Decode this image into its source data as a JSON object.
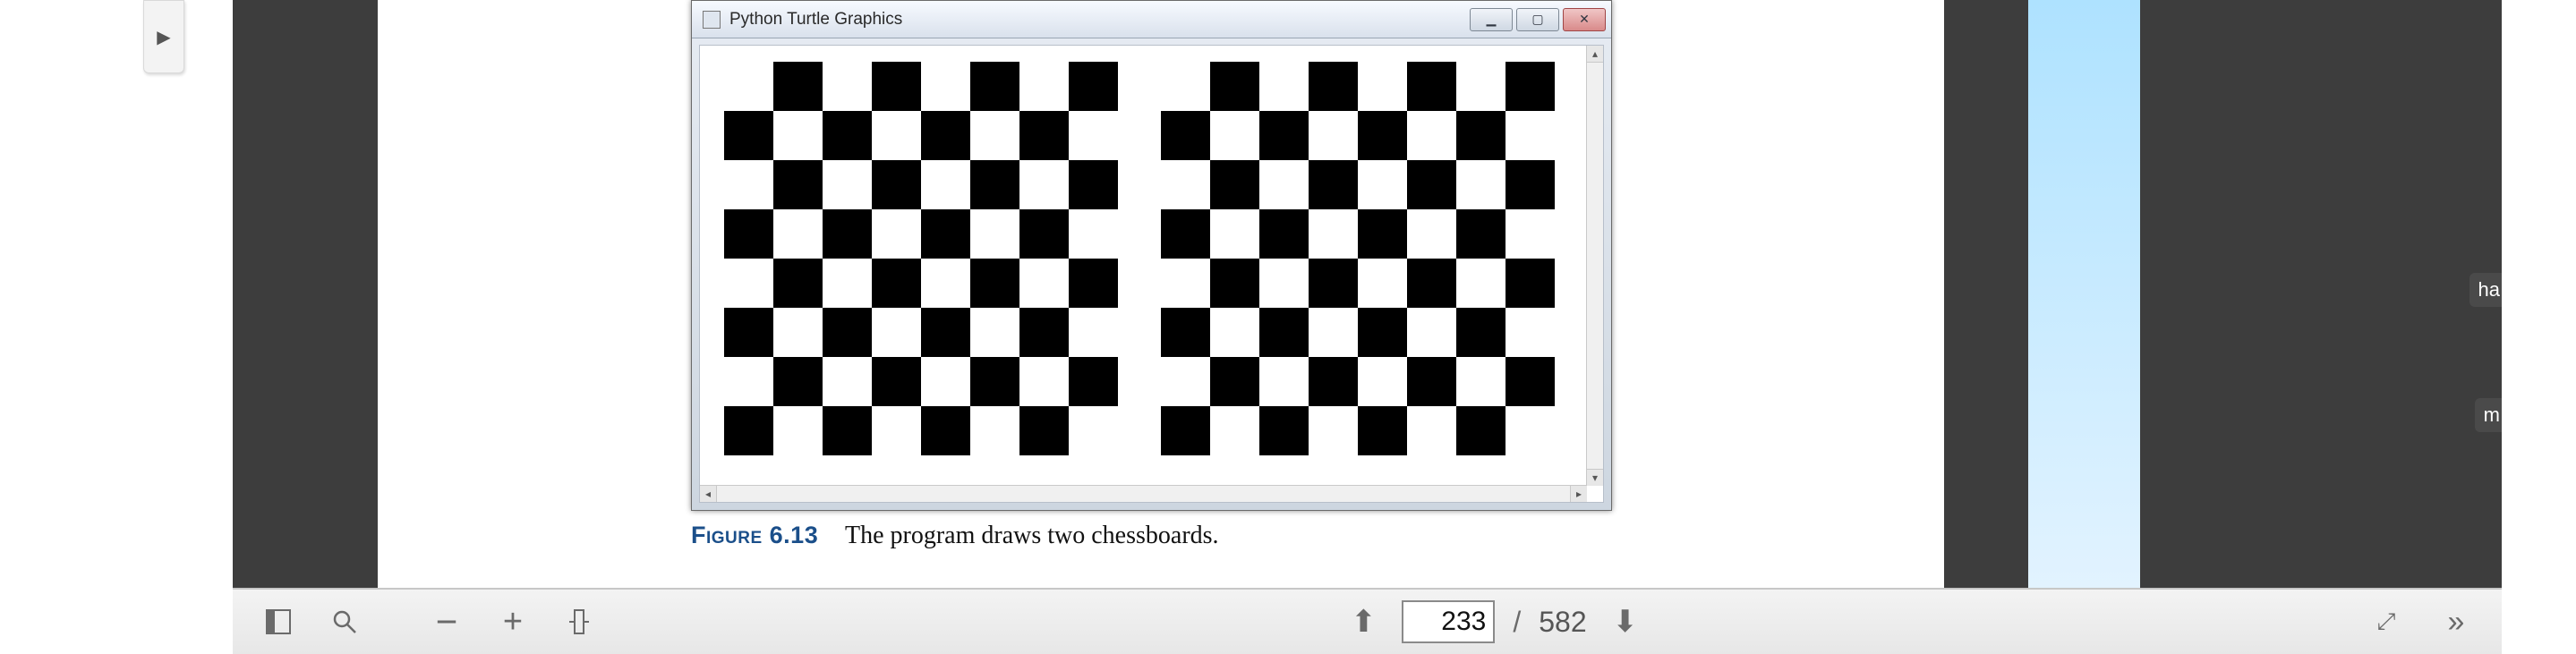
{
  "embedded_window": {
    "title": "Python Turtle Graphics",
    "minimize_tip": "Minimize",
    "maximize_tip": "Maximize",
    "close_tip": "Close",
    "board": {
      "rows": 8,
      "cols": 8,
      "count": 2
    }
  },
  "figure": {
    "label": "Figure 6.13",
    "caption": "The program draws two chessboards."
  },
  "toolbar": {
    "sidebar_tip": "Toggle sidebar",
    "find_tip": "Find",
    "zoom_out_tip": "Zoom out",
    "zoom_in_tip": "Zoom in",
    "zoom_menu_tip": "Zoom",
    "page_up_tip": "Previous page",
    "page_down_tip": "Next page",
    "current_page": "233",
    "page_sep": "/",
    "total_pages": "582",
    "presentation_tip": "Presentation mode",
    "tools_tip": "Tools"
  },
  "toc_fragments": {
    "a": "ha",
    "b": "m"
  },
  "sidebar_chevron": "▶"
}
